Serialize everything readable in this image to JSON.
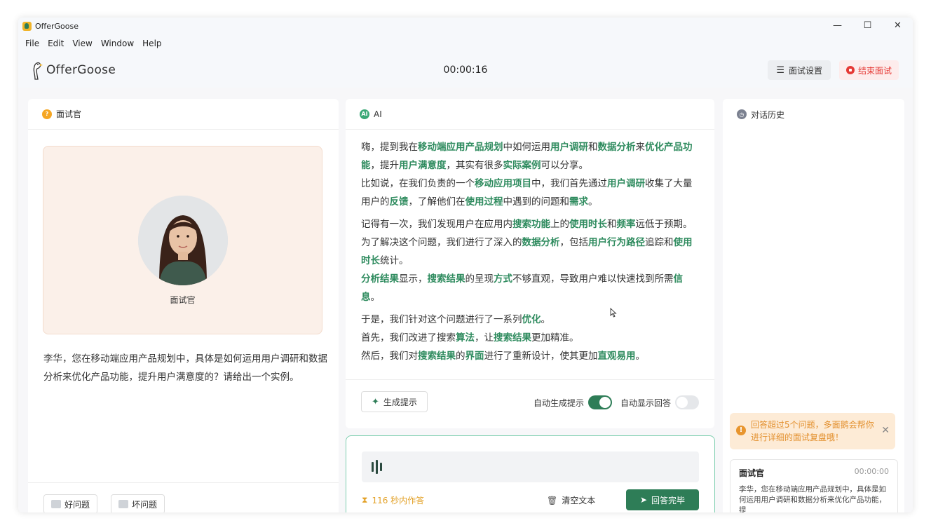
{
  "window": {
    "title": "OfferGoose",
    "controls": {
      "minimize": "—",
      "maximize": "☐",
      "close": "✕"
    }
  },
  "menu": [
    "File",
    "Edit",
    "View",
    "Window",
    "Help"
  ],
  "header": {
    "logo_text": "OfferGoose",
    "timer": "00:00:16",
    "settings_label": "面试设置",
    "end_label": "结束面试"
  },
  "interviewer_panel": {
    "title": "面试官",
    "avatar_name": "面试官",
    "question": "李华，您在移动端应用产品规划中，具体是如何运用用户调研和数据分析来优化产品功能，提升用户满意度的？请给出一个实例。",
    "good_label": "好问题",
    "bad_label": "坏问题"
  },
  "ai_panel": {
    "title": "AI",
    "paragraphs": [
      [
        [
          "嗨，提到我在",
          0
        ],
        [
          "移动端应用产品规划",
          1
        ],
        [
          "中如何运用",
          0
        ],
        [
          "用户调研",
          1
        ],
        [
          "和",
          0
        ],
        [
          "数据分析",
          1
        ],
        [
          "来",
          0
        ],
        [
          "优化产品功能",
          1
        ],
        [
          "，提升",
          0
        ],
        [
          "用户满意度",
          1
        ],
        [
          "，其实有很多",
          0
        ],
        [
          "实际案例",
          1
        ],
        [
          "可以分享。",
          0
        ]
      ],
      [
        [
          "比如说，在我们负责的一个",
          0
        ],
        [
          "移动应用项目",
          1
        ],
        [
          "中，我们首先通过",
          0
        ],
        [
          "用户调研",
          1
        ],
        [
          "收集了大量用户的",
          0
        ],
        [
          "反馈",
          1
        ],
        [
          "，了解他们在",
          0
        ],
        [
          "使用过程",
          1
        ],
        [
          "中遇到的问题和",
          0
        ],
        [
          "需求",
          1
        ],
        [
          "。",
          0
        ]
      ],
      [
        [
          "记得有一次，我们发现用户在应用内",
          0
        ],
        [
          "搜索功能",
          1
        ],
        [
          "上的",
          0
        ],
        [
          "使用时长",
          1
        ],
        [
          "和",
          0
        ],
        [
          "频率",
          1
        ],
        [
          "远低于预期。",
          0
        ]
      ],
      [
        [
          "为了解决这个问题，我们进行了深入的",
          0
        ],
        [
          "数据分析",
          1
        ],
        [
          "，包括",
          0
        ],
        [
          "用户行为路径",
          1
        ],
        [
          "追踪和",
          0
        ],
        [
          "使用时长",
          1
        ],
        [
          "统计。",
          0
        ]
      ],
      [
        [
          "分析结果",
          1
        ],
        [
          "显示，",
          0
        ],
        [
          "搜索结果",
          1
        ],
        [
          "的呈现",
          0
        ],
        [
          "方式",
          1
        ],
        [
          "不够直观，导致用户难以快速找到所需",
          0
        ],
        [
          "信息",
          1
        ],
        [
          "。",
          0
        ]
      ],
      [
        [
          "于是，我们针对这个问题进行了一系列",
          0
        ],
        [
          "优化",
          1
        ],
        [
          "。",
          0
        ]
      ],
      [
        [
          "首先，我们改进了搜索",
          0
        ],
        [
          "算法",
          1
        ],
        [
          "，让",
          0
        ],
        [
          "搜索结果",
          1
        ],
        [
          "更加精准。",
          0
        ]
      ],
      [
        [
          "然后，我们对",
          0
        ],
        [
          "搜索结果",
          1
        ],
        [
          "的",
          0
        ],
        [
          "界面",
          1
        ],
        [
          "进行了重新设计，使其更加",
          0
        ],
        [
          "直观易用",
          1
        ],
        [
          "。",
          0
        ]
      ]
    ],
    "generate_label": "生成提示",
    "auto_hint_label": "自动生成提示",
    "auto_hint_on": true,
    "auto_answer_label": "自动显示回答",
    "auto_answer_on": false
  },
  "answer_box": {
    "countdown": "116 秒内作答",
    "clear_label": "清空文本",
    "done_label": "回答完毕"
  },
  "history_panel": {
    "title": "对话历史",
    "notice": "回答超过5个问题，多面鹅会帮你进行详细的面试复盘哦！",
    "entry": {
      "who": "面试官",
      "time": "00:00:00",
      "text": "李华，您在移动端应用产品规划中，具体是如何运用用户调研和数据分析来优化产品功能，提"
    }
  },
  "colors": {
    "accent": "#2e7d57",
    "highlight": "#2e8b5e",
    "danger": "#e53935",
    "warning": "#e3902e"
  }
}
